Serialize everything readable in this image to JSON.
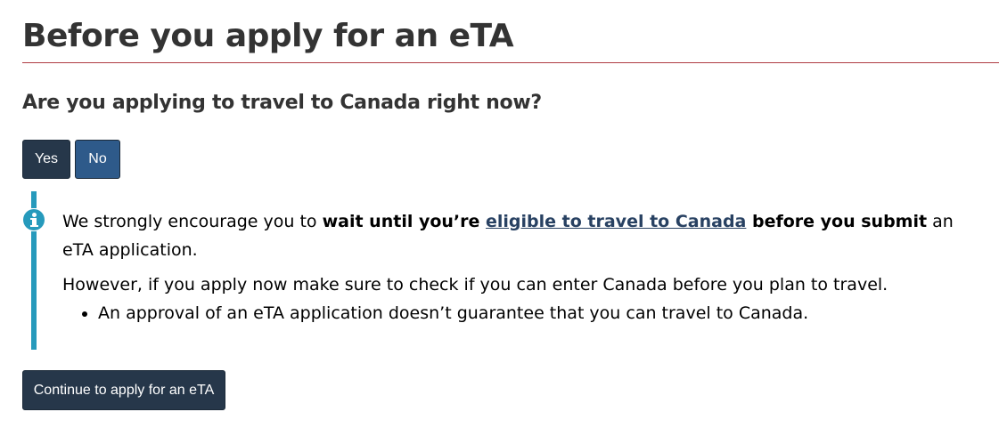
{
  "page": {
    "title": "Before you apply for an eTA",
    "question": "Are you applying to travel to Canada right now?"
  },
  "answer_buttons": {
    "yes_label": "Yes",
    "no_label": "No",
    "selected": "No"
  },
  "notice": {
    "icon": "info-circle-icon",
    "para1_start": "We strongly encourage you to ",
    "para1_bold1": "wait until you’re ",
    "para1_link": "eligible to travel to Canada",
    "para1_bold2": " before you submit",
    "para1_end": " an eTA application.",
    "para2": "However, if you apply now make sure to check if you can enter Canada before you plan to travel.",
    "bullets": [
      "An approval of an eTA application doesn’t guarantee that you can travel to Canada."
    ]
  },
  "actions": {
    "continue_label": "Continue to apply for an eTA"
  },
  "colors": {
    "title_rule": "#af3c43",
    "primary_button": "#26374a",
    "selected_button": "#2e5a8a",
    "info_accent": "#269abc",
    "link": "#284162",
    "text": "#333333"
  }
}
